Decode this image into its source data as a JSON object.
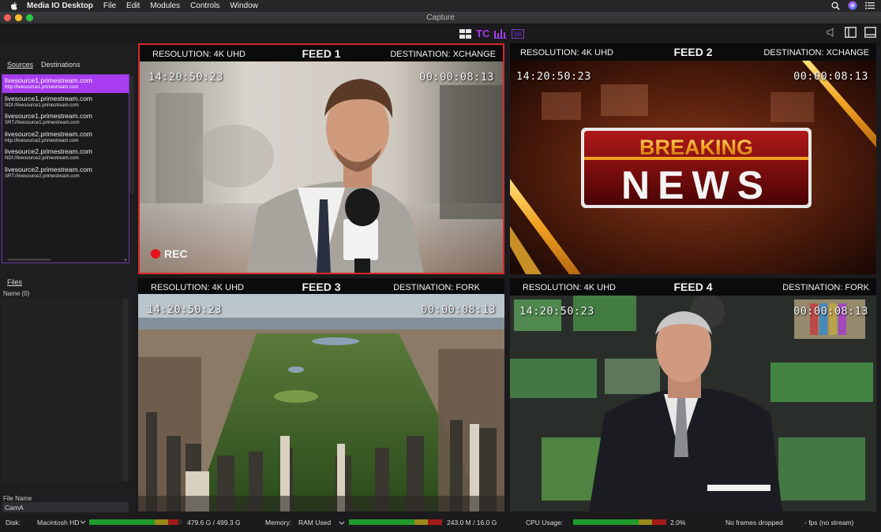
{
  "menubar": {
    "app_name": "Media IO Desktop",
    "items": [
      "File",
      "Edit",
      "Modules",
      "Controls",
      "Window"
    ]
  },
  "window": {
    "title": "Capture"
  },
  "toolbar": {
    "tc_label": "TC"
  },
  "sidebar": {
    "tabs": [
      "Sources",
      "Destinations"
    ],
    "sources": [
      {
        "host": "livesource1.primestream.com",
        "url": "http://livesource1.primestream.com"
      },
      {
        "host": "livesource1.primestream.com",
        "url": "NDI://livesource1.primestream.com"
      },
      {
        "host": "livesource1.primestream.com",
        "url": "SRT://livesource1.primestream.com"
      },
      {
        "host": "livesource2.primestream.com",
        "url": "http://livesource2.primestream.com"
      },
      {
        "host": "livesource2.primestream.com",
        "url": "NDI://livesource2.primestream.com"
      },
      {
        "host": "livesource2.primestream.com",
        "url": "SRT://livesource2.primestream.com"
      }
    ],
    "files_label": "Files",
    "name_column": "Name (0)",
    "file_name_label": "File Name",
    "file_name_value": "CamA"
  },
  "feeds": [
    {
      "title": "FEED 1",
      "resolution": "RESOLUTION: 4K UHD",
      "destination": "DESTINATION: XCHANGE",
      "tc_left": "14:20:50:23",
      "tc_right": "00:00:08:13",
      "rec": "REC"
    },
    {
      "title": "FEED 2",
      "resolution": "RESOLUTION: 4K UHD",
      "destination": "DESTINATION: XCHANGE",
      "tc_left": "14:20:50:23",
      "tc_right": "00:00:08:13",
      "banner_top": "BREAKING",
      "banner_bottom": "NEWS"
    },
    {
      "title": "FEED 3",
      "resolution": "RESOLUTION: 4K UHD",
      "destination": "DESTINATION: FORK",
      "tc_left": "14:20:50:23",
      "tc_right": "00:00:08:13"
    },
    {
      "title": "FEED 4",
      "resolution": "RESOLUTION: 4K UHD",
      "destination": "DESTINATION: FORK",
      "tc_left": "14:20:50:23",
      "tc_right": "00:00:08:13"
    }
  ],
  "status": {
    "disk_label": "Disk:",
    "disk_volume": "Macintosh HD",
    "disk_value": "479.6 G / 499.3 G",
    "disk_fill": 0.96,
    "memory_label": "Memory:",
    "memory_type": "RAM Used",
    "memory_value": "243.0 M / 16.0 G",
    "memory_fill": 1.0,
    "cpu_label": "CPU Usage:",
    "cpu_value": "2.0%",
    "cpu_fill": 1.0,
    "frames": "No frames dropped",
    "fps": "- fps (no stream)"
  },
  "colors": {
    "accent": "#a83cf0",
    "record_border": "#d82828",
    "meter_green": "#1f9a2b",
    "meter_yellow": "#9a8a1a",
    "meter_red": "#a01a1a"
  }
}
